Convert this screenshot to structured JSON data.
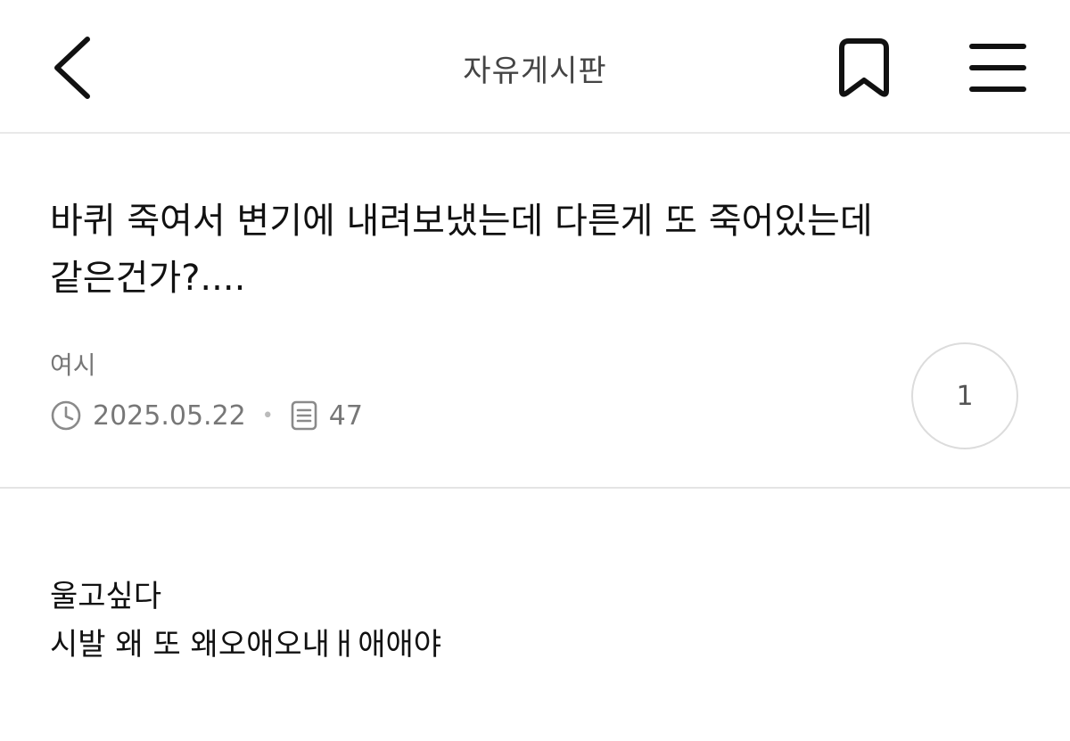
{
  "header": {
    "title": "자유게시판",
    "back_icon": "chevron-left-icon",
    "bookmark_icon": "bookmark-icon",
    "menu_icon": "hamburger-menu-icon"
  },
  "post": {
    "title": "바퀴 죽여서 변기에 내려보냈는데 다른게 또 죽어있는데 같은건가?....",
    "author": "여시",
    "date": "2025.05.22",
    "separator": "•",
    "views": "47",
    "comment_count": "1",
    "body_lines": [
      "울고싶다",
      "시발 왜 또 왜오애오내ㅐ애애야"
    ]
  },
  "colors": {
    "text_primary": "#111111",
    "text_secondary": "#777777",
    "divider": "#e4e4e4"
  }
}
